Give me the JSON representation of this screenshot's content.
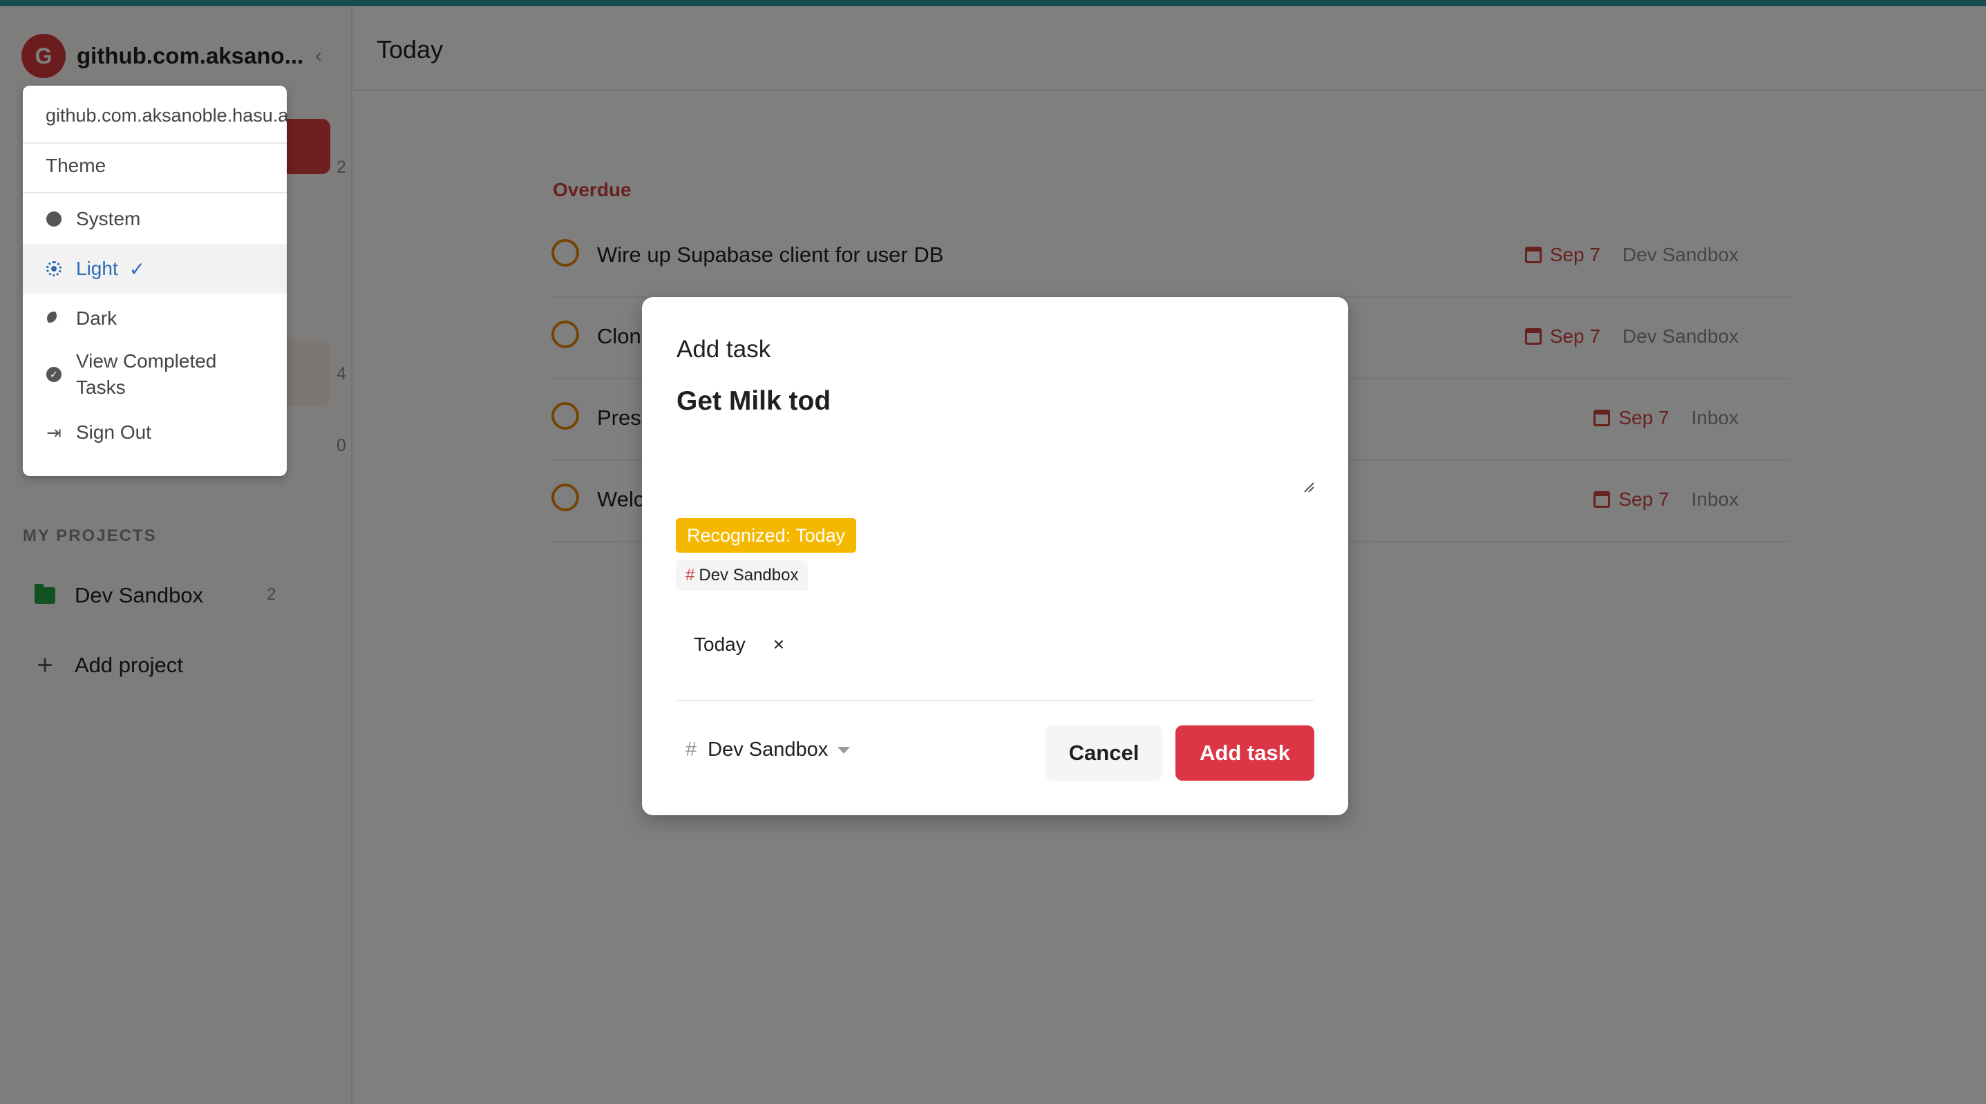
{
  "colors": {
    "accent_bar": "#2a9aa2",
    "brand_red": "#dc3545",
    "overdue_red": "#d1453b",
    "recognized_chip": "#f5b800",
    "project_green": "#25a244",
    "selected_blue": "#2a6db5"
  },
  "sidebar": {
    "avatar_letter": "G",
    "account_name": "github.com.aksano...",
    "collapse_icon": "chevron-left-icon",
    "counts": [
      "2",
      "4",
      "0"
    ],
    "section_label": "MY PROJECTS",
    "projects": [
      {
        "name": "Dev Sandbox",
        "count": "2",
        "icon": "folder-icon"
      }
    ],
    "add_project_label": "Add project"
  },
  "dropdown": {
    "email": "github.com.aksanoble.hasu.app@s",
    "theme_label": "Theme",
    "items": [
      {
        "label": "System",
        "icon": "system-theme-icon"
      },
      {
        "label": "Light",
        "icon": "sun-icon",
        "selected": true
      },
      {
        "label": "Dark",
        "icon": "moon-icon"
      },
      {
        "label": "View Completed Tasks",
        "icon": "check-circle-icon"
      },
      {
        "label": "Sign Out",
        "icon": "sign-out-icon"
      }
    ],
    "check_mark": "✓"
  },
  "main": {
    "title": "Today",
    "section": "Overdue",
    "tasks": [
      {
        "title": "Wire up Supabase client for user DB",
        "due": "Sep 7",
        "project": "Dev Sandbox"
      },
      {
        "title": "Clon",
        "due": "Sep 7",
        "project": "Dev Sandbox"
      },
      {
        "title": "Pres",
        "due": "Sep 7",
        "project": "Inbox"
      },
      {
        "title": "Welc",
        "due": "Sep 7",
        "project": "Inbox"
      }
    ]
  },
  "modal": {
    "title": "Add task",
    "input_value": "Get Milk tod",
    "recognized_label": "Recognized: Today",
    "project_chip": {
      "hash": "#",
      "label": "Dev Sandbox"
    },
    "date_chip": {
      "label": "Today",
      "remove": "×"
    },
    "project_select": {
      "hash": "#",
      "label": "Dev Sandbox"
    },
    "cancel_label": "Cancel",
    "submit_label": "Add task"
  }
}
